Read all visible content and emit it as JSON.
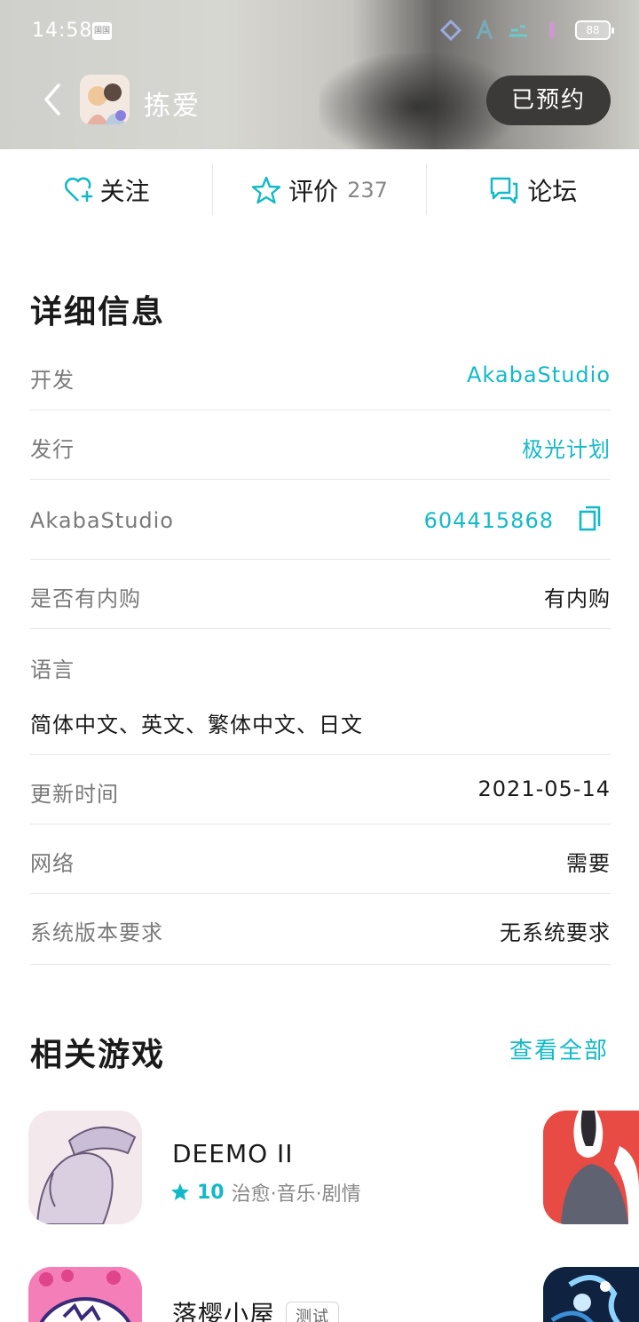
{
  "status_bar": {
    "time": "14:58",
    "sim_label": "国国",
    "battery": "88"
  },
  "header": {
    "app_name": "拣爱",
    "reserve_label": "已预约"
  },
  "actions": {
    "follow": "关注",
    "review": "评价",
    "review_count": "237",
    "forum": "论坛"
  },
  "details": {
    "title": "详细信息",
    "developer_label": "开发",
    "developer_value": "AkabaStudio",
    "publisher_label": "发行",
    "publisher_value": "极光计划",
    "studio_label": "AkabaStudio",
    "studio_value": "604415868",
    "iap_label": "是否有内购",
    "iap_value": "有内购",
    "language_label": "语言",
    "language_value": "简体中文、英文、繁体中文、日文",
    "updated_label": "更新时间",
    "updated_value": "2021-05-14",
    "network_label": "网络",
    "network_value": "需要",
    "system_label": "系统版本要求",
    "system_value": "无系统要求"
  },
  "related": {
    "title": "相关游戏",
    "see_all": "查看全部",
    "games": [
      {
        "name": "DEEMO II",
        "score": "10",
        "tags": "治愈·音乐·剧情"
      },
      {
        "name": "落樱小屋",
        "badge": "测试"
      }
    ]
  },
  "colors": {
    "accent": "#14b9c8",
    "header_button": "#3b3a38"
  }
}
